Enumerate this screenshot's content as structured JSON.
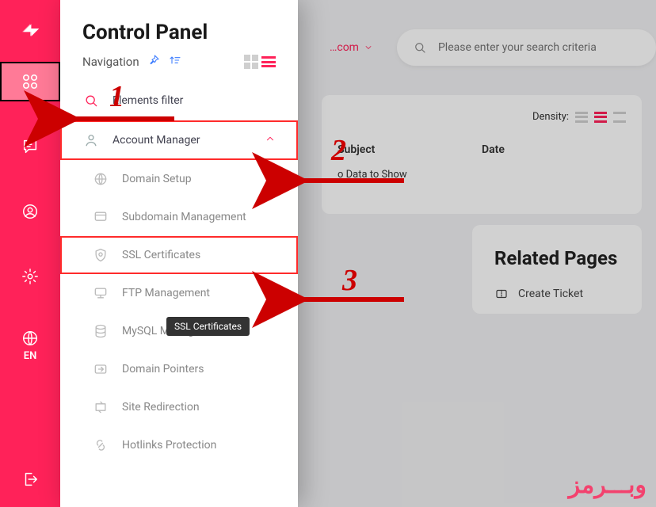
{
  "rail": {
    "lang": "EN"
  },
  "panel": {
    "title": "Control Panel",
    "nav_label": "Navigation",
    "filter_label": "Elements filter",
    "account_label": "Account Manager",
    "sub": {
      "domain_setup": "Domain Setup",
      "subdomain": "Subdomain Management",
      "ssl": "SSL Certificates",
      "ftp": "FTP Management",
      "mysql": "MySQL Management",
      "pointers": "Domain Pointers",
      "redirection": "Site Redirection",
      "hotlinks": "Hotlinks Protection"
    }
  },
  "tooltip": "SSL Certificates",
  "topbar": {
    "domain_hint": "…com",
    "search_placeholder": "Please enter your search criteria"
  },
  "table": {
    "density_label": "Density:",
    "col_subject": "Subject",
    "col_date": "Date",
    "no_data": "o Data to Show"
  },
  "related": {
    "title": "Related Pages",
    "create_ticket": "Create Ticket"
  },
  "anno": {
    "n1": "1",
    "n2": "2",
    "n3": "3"
  },
  "watermark": "وبـــرمز"
}
